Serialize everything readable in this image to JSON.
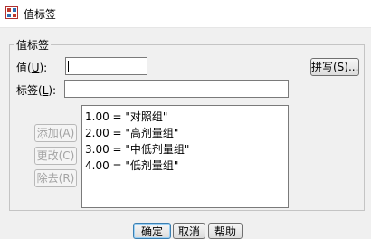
{
  "window": {
    "title": "值标签",
    "icon": "spss-value-label-icon"
  },
  "group": {
    "legend": "值标签"
  },
  "value": {
    "label_text": "值(",
    "label_key": "U",
    "label_tail": "):",
    "current_value": ""
  },
  "label": {
    "label_text": "标签(",
    "label_key": "L",
    "label_tail": "):",
    "current_value": ""
  },
  "buttons": {
    "spell": "拼写(S)...",
    "add": "添加(A)",
    "change": "更改(C)",
    "remove": "除去(R)",
    "ok": "确定",
    "cancel": "取消",
    "help": "帮助"
  },
  "value_labels": [
    "1.00 = \"对照组\"",
    "2.00 = \"高剂量组\"",
    "3.00 = \"中低剂量组\"",
    "4.00 = \"低剂量组\""
  ],
  "colors": {
    "window_bg": "#f0f0f0",
    "titlebar_bg": "#ffffff",
    "disabled_text": "#a3a3a3",
    "default_button_border": "#3c7fb1"
  }
}
